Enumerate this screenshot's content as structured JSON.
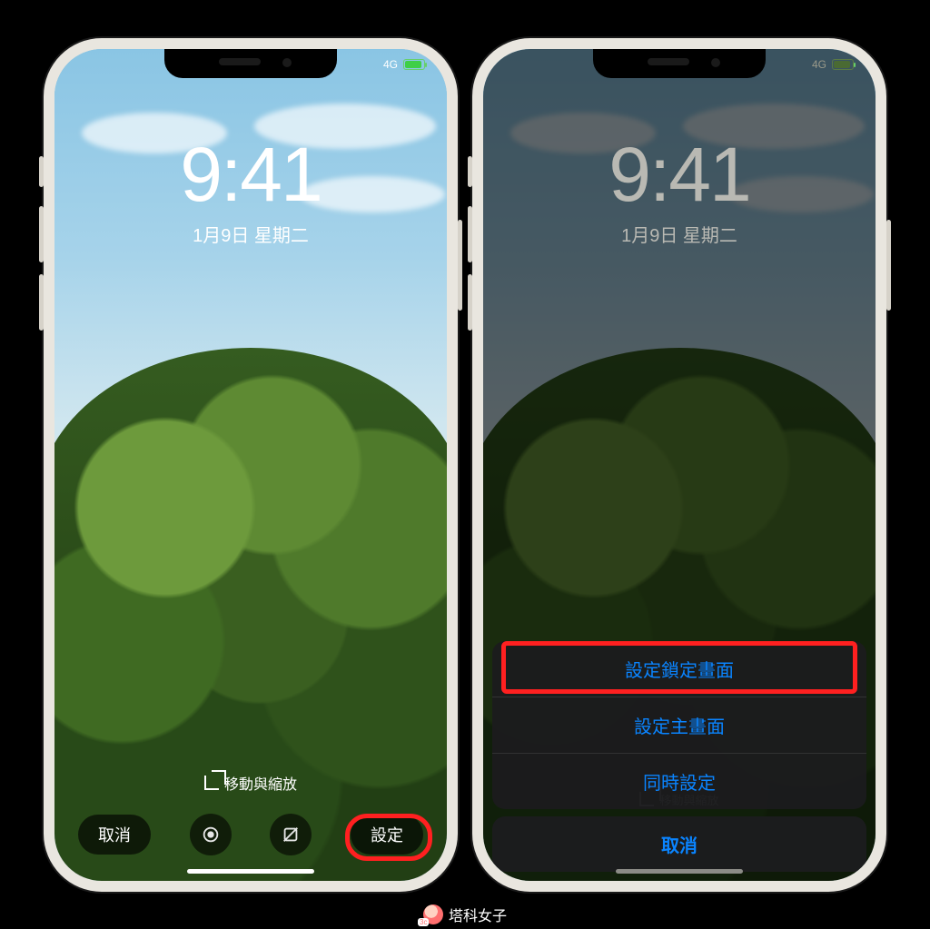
{
  "status": {
    "network": "4G"
  },
  "clock": {
    "time": "9:41",
    "date": "1月9日 星期二"
  },
  "leftPhone": {
    "moveZoom": "移動與縮放",
    "toolbar": {
      "cancel": "取消",
      "set": "設定"
    }
  },
  "rightPhone": {
    "moveZoom": "移動與縮放",
    "sheet": {
      "setLock": "設定鎖定畫面",
      "setHome": "設定主畫面",
      "setBoth": "同時設定",
      "cancel": "取消"
    }
  },
  "watermark": "塔科女子"
}
